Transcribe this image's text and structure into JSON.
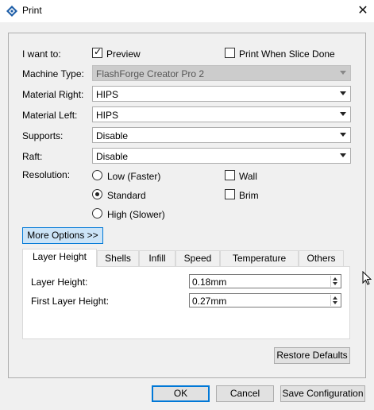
{
  "window": {
    "title": "Print",
    "close_glyph": "✕"
  },
  "form": {
    "i_want_to_label": "I want to:",
    "preview_label": "Preview",
    "preview_checked": true,
    "print_when_done_label": "Print When Slice Done",
    "print_when_done_checked": false,
    "machine_type_label": "Machine Type:",
    "machine_type_value": "FlashForge Creator Pro 2",
    "material_right_label": "Material Right:",
    "material_right_value": "HIPS",
    "material_left_label": "Material Left:",
    "material_left_value": "HIPS",
    "supports_label": "Supports:",
    "supports_value": "Disable",
    "raft_label": "Raft:",
    "raft_value": "Disable",
    "resolution_label": "Resolution:",
    "resolution_options": [
      "Low (Faster)",
      "Standard",
      "High (Slower)"
    ],
    "resolution_selected": "Standard",
    "wall_label": "Wall",
    "wall_checked": false,
    "brim_label": "Brim",
    "brim_checked": false,
    "more_options_label": "More Options >>"
  },
  "tabs": {
    "items": [
      "Layer Height",
      "Shells",
      "Infill",
      "Speed",
      "Temperature",
      "Others"
    ],
    "active": "Layer Height"
  },
  "layer_height": {
    "layer_height_label": "Layer Height:",
    "layer_height_value": "0.18mm",
    "first_layer_height_label": "First Layer Height:",
    "first_layer_height_value": "0.27mm"
  },
  "buttons": {
    "restore_defaults": "Restore Defaults",
    "ok": "OK",
    "cancel": "Cancel",
    "save_configuration": "Save Configuration"
  },
  "colors": {
    "accent": "#0078d7",
    "app_icon": "#1f5fa8"
  },
  "icons": {
    "app": "flashprint-diamond-icon",
    "cursor": "mouse-pointer-icon"
  }
}
